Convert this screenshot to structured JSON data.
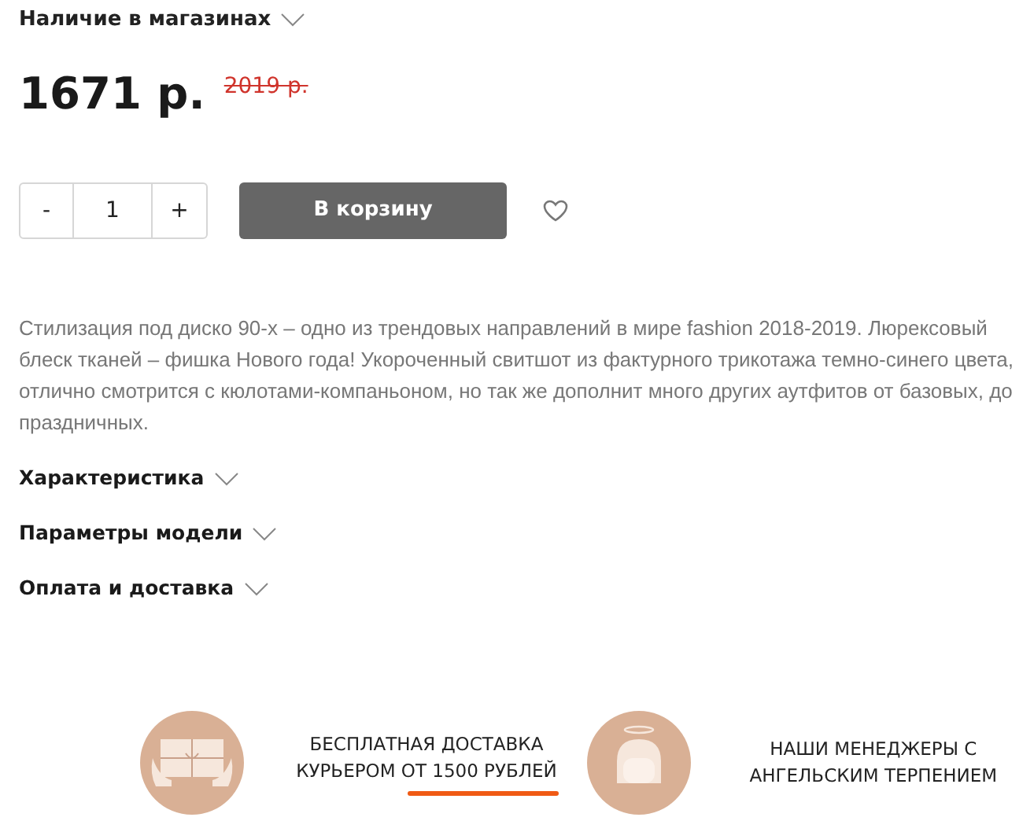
{
  "availability": {
    "label": "Наличие в магазинах"
  },
  "price": {
    "current": "1671 р.",
    "old": "2019 р."
  },
  "quantity": {
    "minus": "-",
    "value": "1",
    "plus": "+"
  },
  "cart_button": "В корзину",
  "description": "Стилизация под диско 90-х – одно из трендовых направлений в мире fashion 2018-2019. Люрексовый блеск тканей – фишка Нового года! Укороченный свитшот из фактурного трикотажа темно-синего цвета, отлично смотрится с кюлотами-компаньоном, но так же дополнит много других аутфитов от базовых, до праздничных.",
  "sections": [
    {
      "label": "Характеристика"
    },
    {
      "label": "Параметры модели"
    },
    {
      "label": "Оплата и доставка"
    }
  ],
  "features": [
    {
      "kind": "gift",
      "lines": [
        "БЕСПЛАТНАЯ ДОСТАВКА",
        "КУРЬЕРОМ ОТ 1500 РУБЛЕЙ"
      ]
    },
    {
      "kind": "manager",
      "lines": [
        "НАШИ МЕНЕДЖЕРЫ С",
        "АНГЕЛЬСКИМ ТЕРПЕНИЕМ"
      ]
    }
  ]
}
